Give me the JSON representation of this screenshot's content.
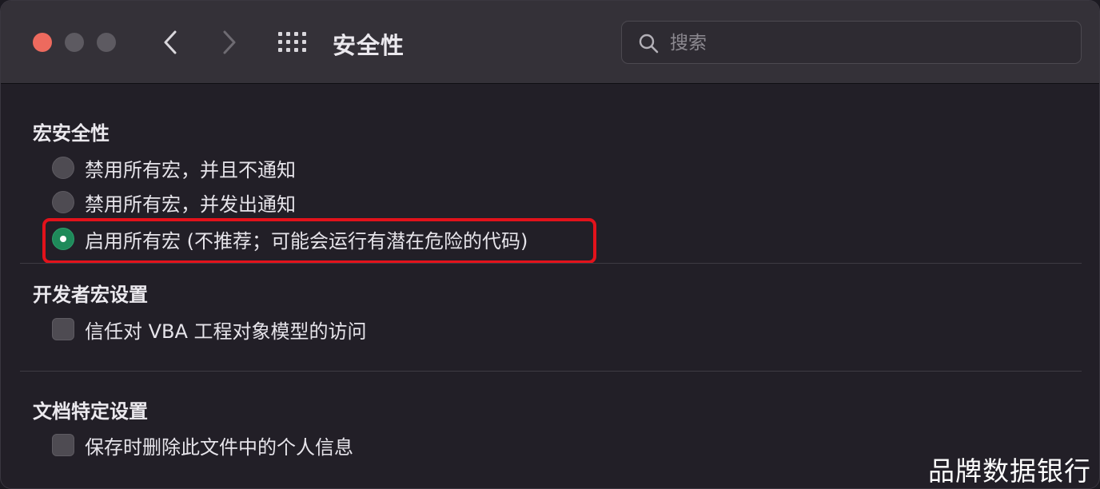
{
  "window": {
    "title": "安全性",
    "search_placeholder": "搜索"
  },
  "macro_security": {
    "title": "宏安全性",
    "options": [
      {
        "label": "禁用所有宏，并且不通知",
        "selected": false
      },
      {
        "label": "禁用所有宏，并发出通知",
        "selected": false
      },
      {
        "label": "启用所有宏 (不推荐；可能会运行有潜在危险的代码)",
        "selected": true
      }
    ]
  },
  "developer_macro": {
    "title": "开发者宏设置",
    "checkbox": {
      "label": "信任对 VBA 工程对象模型的访问",
      "checked": false
    }
  },
  "document_settings": {
    "title": "文档特定设置",
    "checkbox": {
      "label": "保存时删除此文件中的个人信息",
      "checked": false
    }
  },
  "watermark": "品牌数据银行",
  "colors": {
    "close": "#ed6a5e",
    "radio_selected": "#1f8a5a",
    "highlight_border": "#e3121b"
  }
}
